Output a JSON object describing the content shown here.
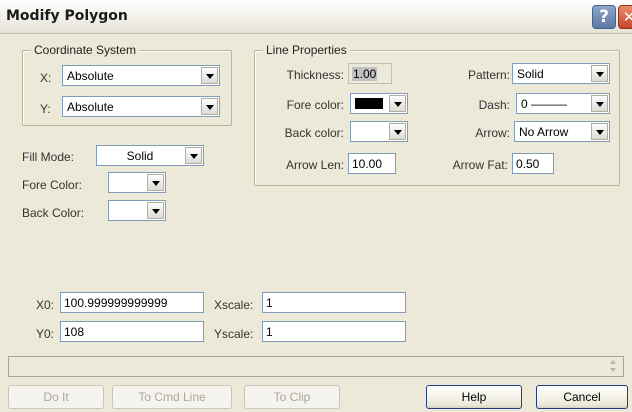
{
  "window": {
    "title": "Modify Polygon",
    "help_glyph": "?",
    "close_glyph": "✕"
  },
  "coordinate_system": {
    "title": "Coordinate System",
    "x_label": "X:",
    "x_value": "Absolute",
    "y_label": "Y:",
    "y_value": "Absolute"
  },
  "line_properties": {
    "title": "Line Properties",
    "thickness_label": "Thickness:",
    "thickness_value": "1.00",
    "fore_color_label": "Fore color:",
    "fore_color_value": "#000000",
    "back_color_label": "Back color:",
    "back_color_value": "#ffffff",
    "arrow_len_label": "Arrow Len:",
    "arrow_len_value": "10.00",
    "pattern_label": "Pattern:",
    "pattern_value": "Solid",
    "dash_label": "Dash:",
    "dash_value": "0 ———",
    "arrow_label": "Arrow:",
    "arrow_value": "No Arrow",
    "arrow_fat_label": "Arrow Fat:",
    "arrow_fat_value": "0.50"
  },
  "fill": {
    "fill_mode_label": "Fill Mode:",
    "fill_mode_value": "Solid",
    "fore_color_label": "Fore Color:",
    "fore_color_value": "",
    "back_color_label": "Back Color:",
    "back_color_value": ""
  },
  "position": {
    "x0_label": "X0:",
    "x0_value": "100.999999999999",
    "y0_label": "Y0:",
    "y0_value": "108",
    "xscale_label": "Xscale:",
    "xscale_value": "1",
    "yscale_label": "Yscale:",
    "yscale_value": "1"
  },
  "status_text": "",
  "buttons": {
    "do_it": "Do It",
    "to_cmd_line": "To Cmd Line",
    "to_clip": "To Clip",
    "help": "Help",
    "cancel": "Cancel"
  }
}
